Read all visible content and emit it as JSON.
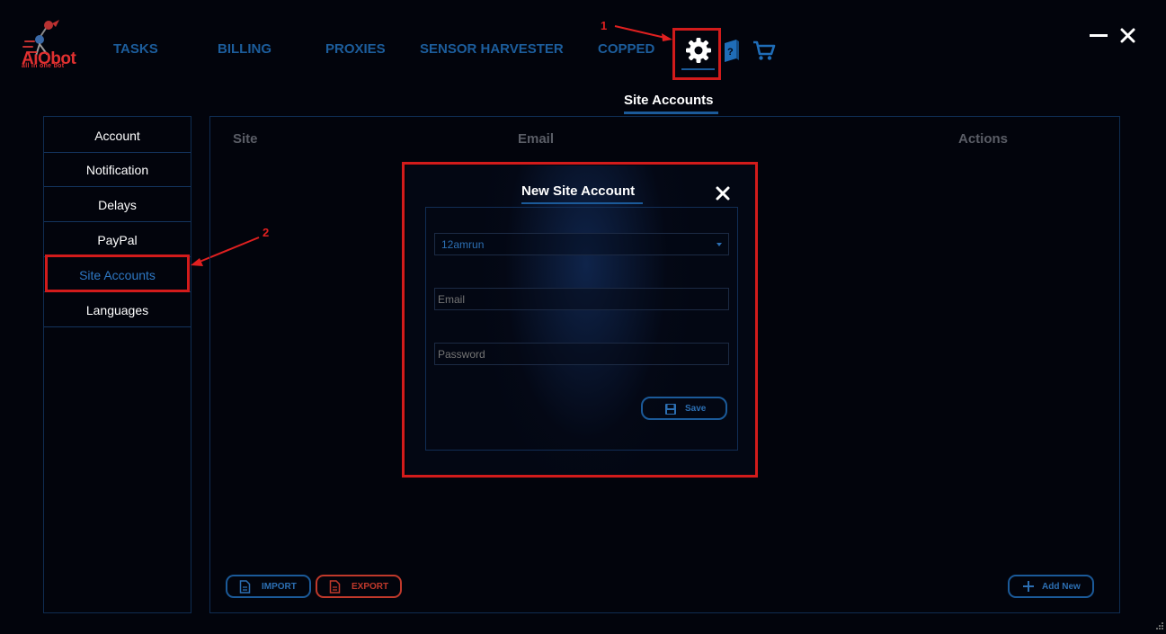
{
  "brand": {
    "name": "AiObot",
    "tagline": "all in one bot"
  },
  "nav": [
    {
      "label": "TASKS"
    },
    {
      "label": "BILLING"
    },
    {
      "label": "PROXIES"
    },
    {
      "label": "SENSOR HARVESTER"
    },
    {
      "label": "COPPED"
    }
  ],
  "annotations": {
    "one": "1",
    "two": "2"
  },
  "page_title": "Site Accounts",
  "sidebar": {
    "items": [
      {
        "label": "Account"
      },
      {
        "label": "Notification"
      },
      {
        "label": "Delays"
      },
      {
        "label": "PayPal"
      },
      {
        "label": "Site Accounts",
        "active": true
      },
      {
        "label": "Languages"
      }
    ]
  },
  "table": {
    "columns": [
      "Site",
      "Email",
      "Actions"
    ]
  },
  "footer": {
    "import_label": "IMPORT",
    "export_label": "EXPORT",
    "add_label": "Add New"
  },
  "modal": {
    "title": "New Site Account",
    "site_value": "12amrun",
    "email_placeholder": "Email",
    "password_placeholder": "Password",
    "save_label": "Save"
  },
  "colors": {
    "accent": "#1b5a99",
    "background": "#02040c",
    "highlight": "#d21b1b",
    "export": "#c0392b"
  },
  "icons": [
    "settings-gear-icon",
    "help-book-icon",
    "cart-icon",
    "minimize-icon",
    "close-icon",
    "import-file-icon",
    "export-file-icon",
    "plus-icon",
    "floppy-save-icon",
    "resize-grip-icon"
  ]
}
